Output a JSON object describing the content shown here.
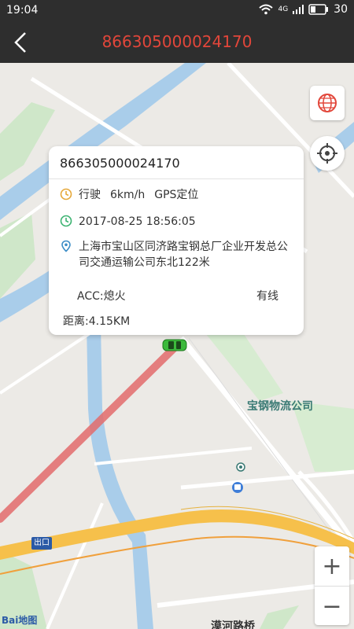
{
  "status_bar": {
    "time": "19:04",
    "network": "4G",
    "battery": "30"
  },
  "nav": {
    "title": "866305000024170"
  },
  "popup": {
    "device_id": "866305000024170",
    "motion": "行驶",
    "speed": "6km/h",
    "location_mode": "GPS定位",
    "timestamp": "2017-08-25 18:56:05",
    "address": "上海市宝山区同济路宝钢总厂企业开发总公司交通运输公司东北122米",
    "acc": "ACC:熄火",
    "connection": "有线",
    "distance": "距离:4.15KM"
  },
  "map": {
    "poi_label": "宝钢物流公司",
    "exit_label": "出口",
    "street_label": "漠河路桥",
    "logo_text": "Bai地图",
    "zoom_in": "+",
    "zoom_out": "−",
    "colors": {
      "road_yellow": "#f6c04b",
      "water": "#a9cdea",
      "green": "#cfe7c9",
      "route": "#e36b6b",
      "car": "#3cba3c"
    }
  }
}
